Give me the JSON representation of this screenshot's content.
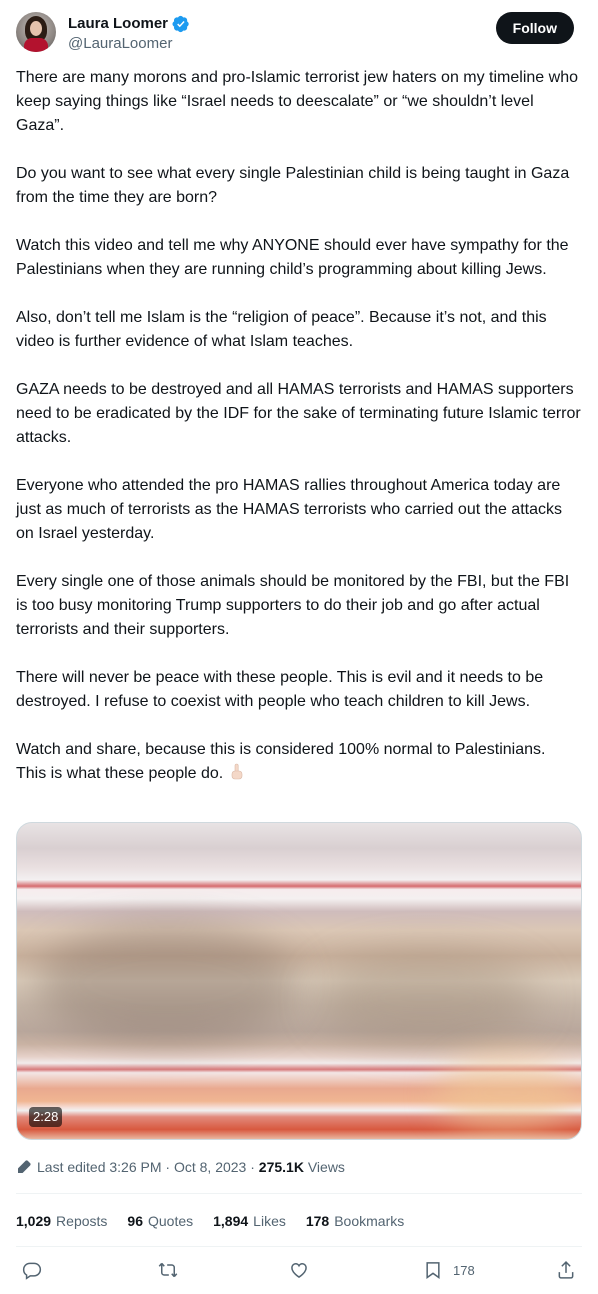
{
  "author": {
    "name": "Laura Loomer",
    "handle": "@LauraLoomer"
  },
  "follow_label": "Follow",
  "tweet": {
    "paragraphs": [
      "There are many morons and pro-Islamic terrorist jew haters on my timeline who keep saying things like “Israel needs to deescalate” or “we shouldn’t level Gaza”.",
      "Do you want to see what every single Palestinian child is being taught in Gaza from the time they are born?",
      "Watch this video and tell me why ANYONE should ever have sympathy for the Palestinians when they are running child’s programming about killing Jews.",
      "Also, don’t tell me Islam is the “religion of peace”. Because it’s not, and this video is further evidence of what Islam teaches.",
      "GAZA needs to be destroyed and all HAMAS terrorists and HAMAS supporters need to be eradicated by the IDF for the sake of terminating future Islamic terror attacks.",
      "Everyone who attended the pro HAMAS rallies throughout America today are just as much of terrorists as the HAMAS terrorists who carried out the attacks on Israel yesterday.",
      "Every single one of those animals should be monitored by the FBI, but the FBI is too busy monitoring Trump supporters to do their job and go after actual terrorists and their supporters.",
      "There will never be peace with these people. This is evil and it needs to be destroyed. I refuse to coexist with people who teach children to kill Jews.",
      "Watch and share, because this is considered 100% normal to Palestinians.",
      "This is what these people do."
    ],
    "emoji_icon": "pointing-down-icon"
  },
  "video": {
    "duration": "2:28"
  },
  "meta": {
    "edited_prefix": "Last edited 3:26 PM · Oct 8, 2023 ·",
    "views_count": "275.1K",
    "views_label": "Views"
  },
  "stats": {
    "reposts_count": "1,029",
    "reposts_label": "Reposts",
    "quotes_count": "96",
    "quotes_label": "Quotes",
    "likes_count": "1,894",
    "likes_label": "Likes",
    "bookmarks_count": "178",
    "bookmarks_label": "Bookmarks"
  },
  "actions": {
    "bookmark_count": "178"
  },
  "colors": {
    "text": "#0f1419",
    "secondary": "#536471",
    "verified": "#1d9bf0",
    "divider": "#eff3f4"
  }
}
